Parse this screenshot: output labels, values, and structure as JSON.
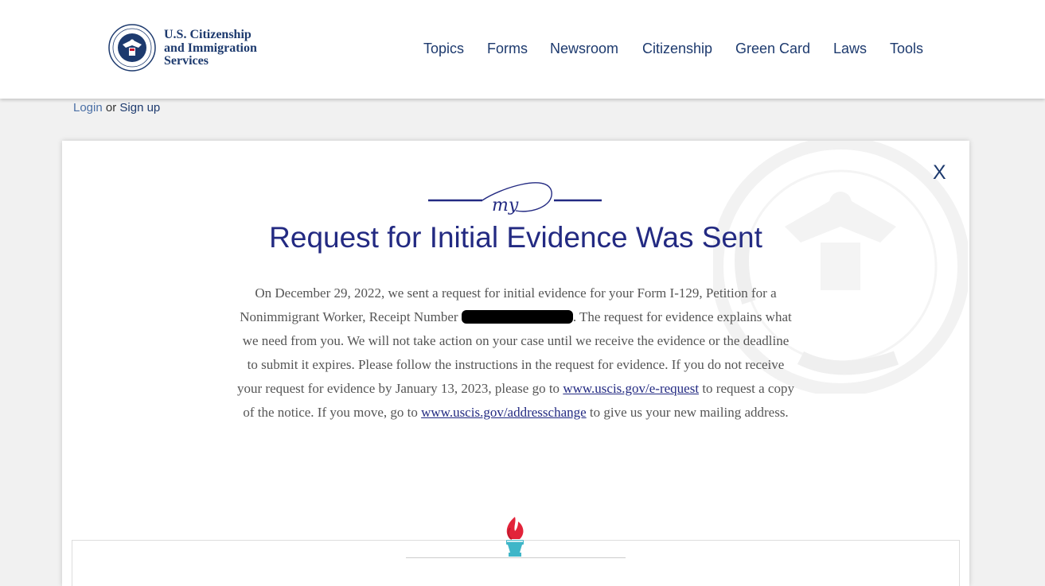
{
  "header": {
    "agency_line1": "U.S. Citizenship",
    "agency_line2": "and Immigration",
    "agency_line3": "Services",
    "seal_icon": "dhs-seal-icon",
    "nav": [
      "Topics",
      "Forms",
      "Newsroom",
      "Citizenship",
      "Green Card",
      "Laws",
      "Tools"
    ]
  },
  "auth": {
    "login": "Login",
    "or": "or",
    "signup": "Sign up"
  },
  "modal": {
    "close": "X",
    "logo_text": "my",
    "title": "Request for Initial Evidence Was Sent",
    "body_part1": "On December 29, 2022, we sent a request for initial evidence for your Form I-129, Petition for a Nonimmigrant Worker, Receipt Number ",
    "body_part2": ". The request for evidence explains what we need from you. We will not take action on your case until we receive the evidence or the deadline to submit it expires. Please follow the instructions in the request for evidence. If you do not receive your request for evidence by January 13, 2023, please go to ",
    "link1": "www.uscis.gov/e-request",
    "body_part3": " to request a copy of the notice. If you move, go to ",
    "link2": "www.uscis.gov/addresschange",
    "body_part4": " to give us your new mailing address.",
    "torch_icon": "torch-icon",
    "watermark_icon": "dhs-seal-watermark-icon"
  },
  "colors": {
    "navy": "#1d3a6e",
    "title_blue": "#232a82",
    "background": "#f1f1f1"
  }
}
